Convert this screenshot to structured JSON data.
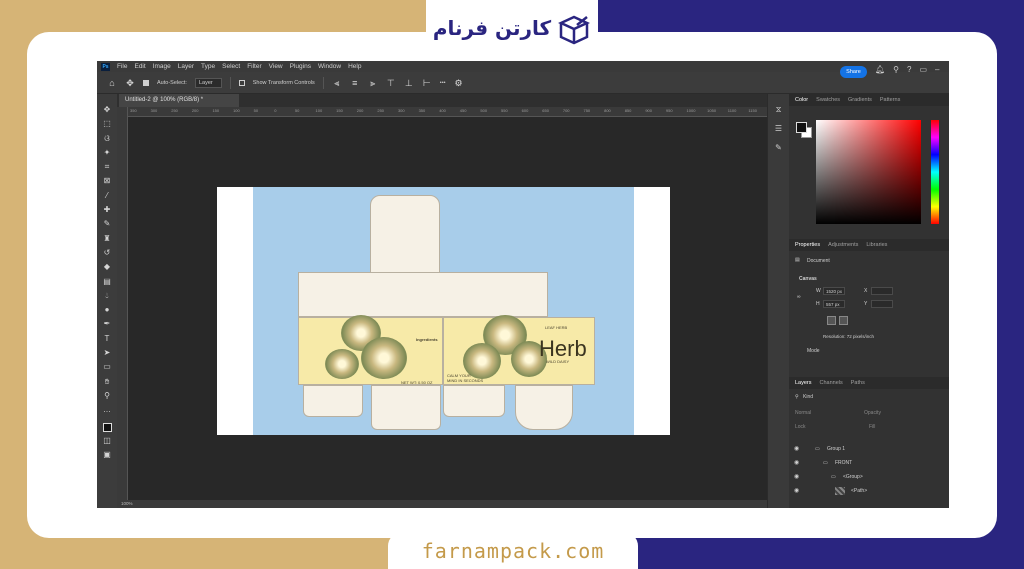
{
  "brand": {
    "logo_text": "کارتن فرنام",
    "url": "farnampack.com"
  },
  "photoshop": {
    "app_badge": "Ps",
    "menu": [
      "File",
      "Edit",
      "Image",
      "Layer",
      "Type",
      "Select",
      "Filter",
      "View",
      "Plugins",
      "Window",
      "Help"
    ],
    "options": {
      "auto_select_label": "Auto-Select:",
      "auto_select_value": "Layer",
      "show_transform_label": "Show Transform Controls",
      "more_label": "•••",
      "share_label": "Share"
    },
    "document_tab": "Untitled-2 @ 100% (RGB/8) *",
    "ruler_ticks": [
      "350",
      "300",
      "250",
      "200",
      "150",
      "100",
      "50",
      "0",
      "50",
      "100",
      "150",
      "200",
      "250",
      "300",
      "350",
      "400",
      "450",
      "500",
      "550",
      "600",
      "650",
      "700",
      "750",
      "800",
      "850",
      "900",
      "950",
      "1000",
      "1050",
      "1100",
      "1150"
    ],
    "status": "100%",
    "color_panel": {
      "tabs": [
        "Color",
        "Swatches",
        "Gradients",
        "Patterns"
      ],
      "active": "Color",
      "fg_color": "#111111",
      "bg_color": "#ffffff"
    },
    "properties_panel": {
      "tabs": [
        "Properties",
        "Adjustments",
        "Libraries"
      ],
      "active": "Properties",
      "document_label": "Document",
      "canvas_label": "Canvas",
      "width_label": "W",
      "width_value": "1520 px",
      "height_label": "H",
      "height_value": "557 px",
      "x_label": "X",
      "y_label": "Y",
      "resolution": "Resolution: 72 pixels/inch",
      "mode_label": "Mode"
    },
    "layers_panel": {
      "tabs": [
        "Layers",
        "Channels",
        "Paths"
      ],
      "active": "Layers",
      "kind_label": "Kind",
      "normal_label": "Normal",
      "opacity_label": "Opacity",
      "lock_label": "Lock",
      "fill_label": "Fill",
      "layers": [
        {
          "name": "Group 1"
        },
        {
          "name": "FRONT"
        },
        {
          "name": "<Group>"
        },
        {
          "name": "<Path>"
        }
      ]
    }
  },
  "artwork": {
    "herb_title": "Herb",
    "subtitle": "WILD DAISY",
    "tag": "LEAF HERB",
    "ingredients": "Ingredients",
    "calm": "CALM YOUR\nMIND IN SECONDS",
    "net_wt": "NET WT: 0.50 OZ"
  },
  "colors": {
    "accent_blue": "#1473e6",
    "box_background": "#a8cdea",
    "panel_cream": "#f6f1e6",
    "panel_yellow": "#f7eaa8",
    "brand_navy": "#2a2580",
    "brand_gold": "#d6b476"
  }
}
